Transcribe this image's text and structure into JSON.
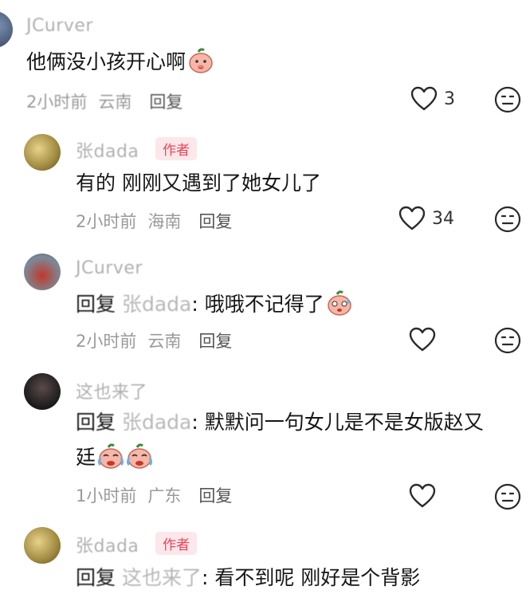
{
  "comments": [
    {
      "username": "JCurver",
      "text": "他俩没小孩开心啊",
      "time": "2小时前",
      "location": "云南",
      "reply_label": "回复",
      "likes": "3"
    },
    {
      "username": "张dada",
      "author_tag": "作者",
      "text": "有的 刚刚又遇到了她女儿了",
      "time": "2小时前",
      "location": "海南",
      "reply_label": "回复",
      "likes": "34"
    },
    {
      "username": "JCurver",
      "reply_prefix": "回复",
      "reply_to": "张dada",
      "text": ": 哦哦不记得了",
      "time": "2小时前",
      "location": "云南",
      "reply_label": "回复"
    },
    {
      "username": "这也来了",
      "reply_prefix": "回复",
      "reply_to": "张dada",
      "text_line1": ": 默默问一句女儿是不是女版赵又",
      "text_line2": "廷",
      "time": "1小时前",
      "location": "广东",
      "reply_label": "回复"
    },
    {
      "username": "张dada",
      "author_tag": "作者",
      "reply_prefix": "回复",
      "reply_to": "这也来了",
      "text": ": 看不到呢 刚好是个背影"
    }
  ],
  "icons": {
    "like": "heart-outline-icon",
    "dislike": "neutral-face-icon",
    "emoji_peach": "peach-face-emoji",
    "emoji_sweat": "peach-sweat-emoji",
    "emoji_cry": "peach-cry-emoji"
  },
  "colors": {
    "author_tag_text": "#e8455a",
    "author_tag_bg": "#fde7ea",
    "meta": "#9a9a9a"
  }
}
